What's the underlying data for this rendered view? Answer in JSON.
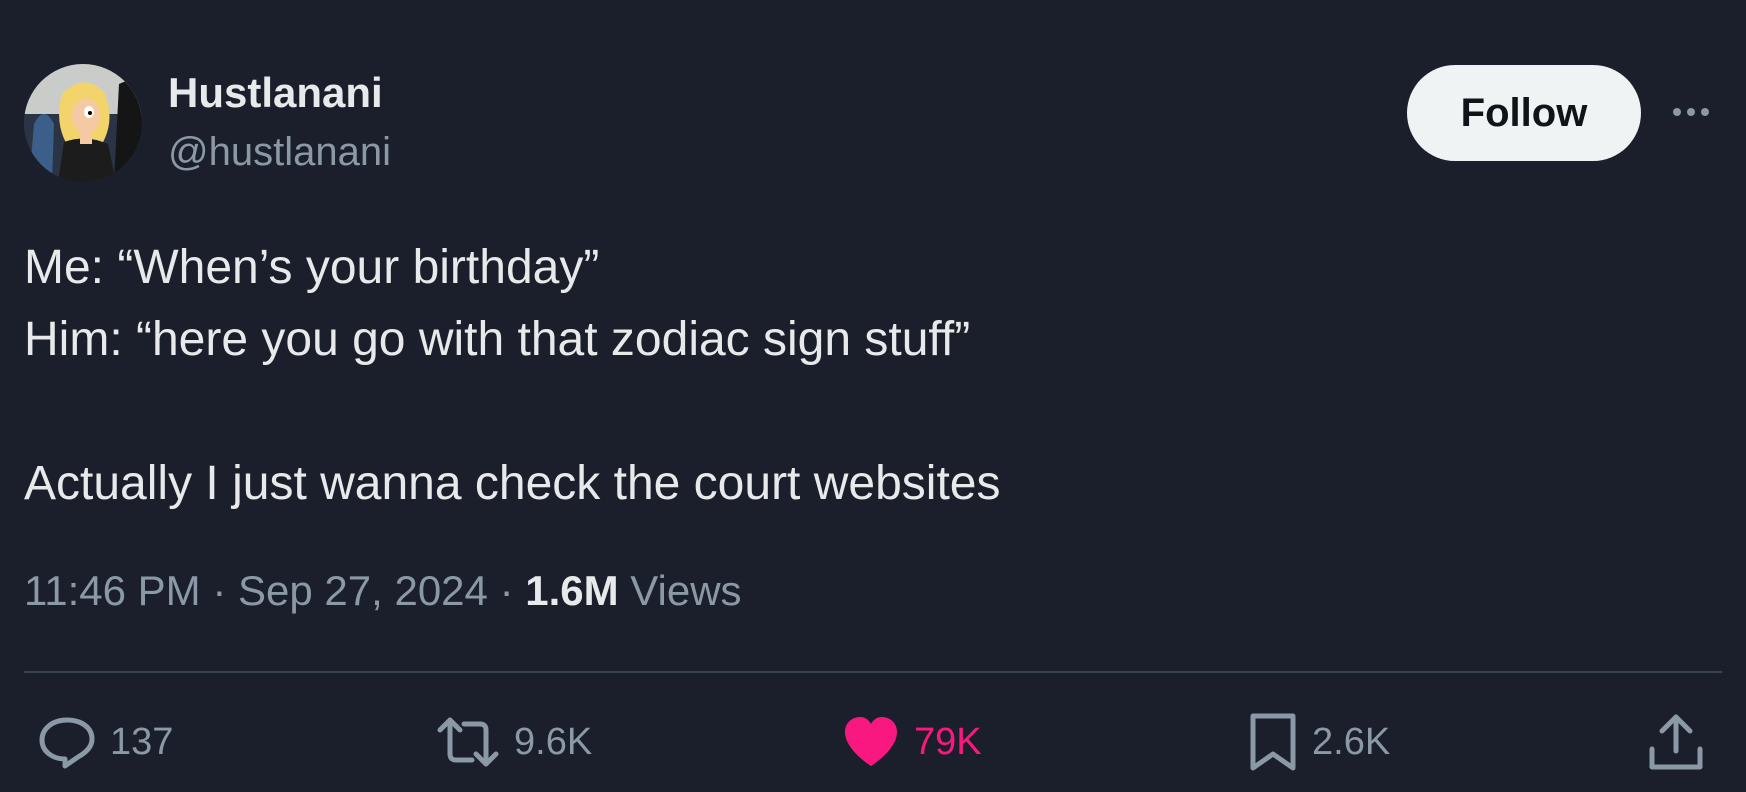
{
  "author": {
    "display_name": "Hustlanani",
    "handle": "@hustlanani",
    "avatar_icon": "cartoon-woman-avatar"
  },
  "follow_button": {
    "label": "Follow"
  },
  "more_button": {
    "icon": "more-horizontal-icon"
  },
  "tweet": {
    "lines": [
      "Me: “When’s your birthday”",
      "Him: “here you go with that zodiac sign stuff”",
      "",
      "Actually I just wanna check the court websites"
    ]
  },
  "meta": {
    "time": "11:46 PM",
    "separator": "·",
    "date": "Sep 27, 2024",
    "views_count": "1.6M",
    "views_label": "Views"
  },
  "actions": {
    "reply": {
      "icon": "reply-icon",
      "count": "137"
    },
    "retweet": {
      "icon": "retweet-icon",
      "count": "9.6K"
    },
    "like": {
      "icon": "heart-icon",
      "count": "79K",
      "active": true,
      "color": "#f91880"
    },
    "bookmark": {
      "icon": "bookmark-icon",
      "count": "2.6K"
    },
    "share": {
      "icon": "share-icon"
    }
  },
  "colors": {
    "background": "#1a1f2b",
    "text": "#e7e9ea",
    "secondary": "#8b98a5",
    "like": "#f91880",
    "follow_bg": "#eff3f4"
  }
}
